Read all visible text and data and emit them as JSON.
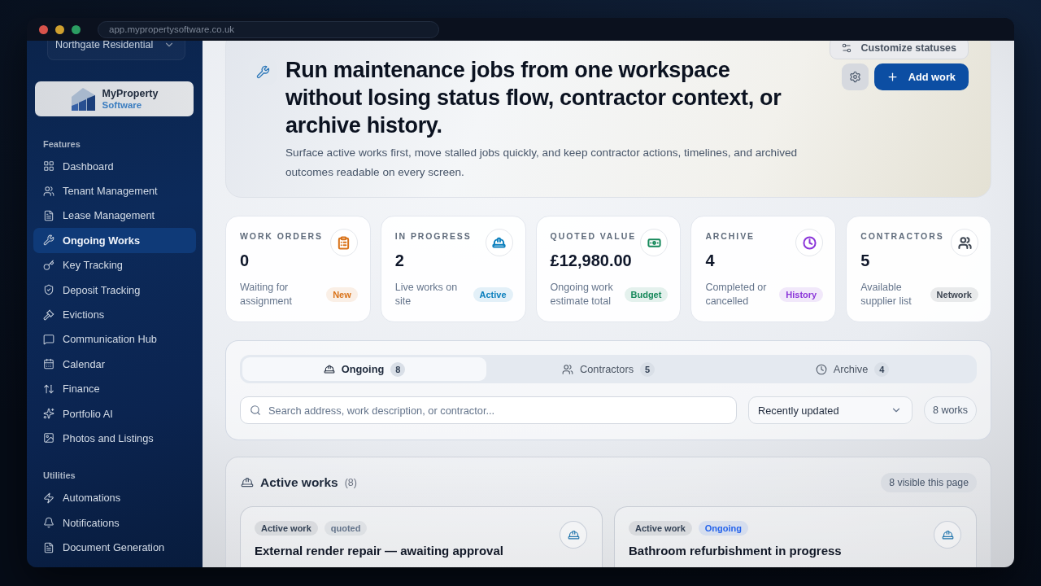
{
  "browser": {
    "url": "app.mypropertysoftware.co.uk"
  },
  "sidebar": {
    "workspace": "Northgate Residential",
    "logo": {
      "name": "MyProperty",
      "subtitle": "Software"
    },
    "sections": [
      {
        "title": "Features",
        "items": [
          {
            "label": "Dashboard",
            "selected": false
          },
          {
            "label": "Tenant Management",
            "selected": false
          },
          {
            "label": "Lease Management",
            "selected": false
          },
          {
            "label": "Ongoing Works",
            "selected": true
          },
          {
            "label": "Key Tracking",
            "selected": false
          },
          {
            "label": "Deposit Tracking",
            "selected": false
          },
          {
            "label": "Evictions",
            "selected": false
          },
          {
            "label": "Communication Hub",
            "selected": false
          },
          {
            "label": "Calendar",
            "selected": false
          },
          {
            "label": "Finance",
            "selected": false
          },
          {
            "label": "Portfolio AI",
            "selected": false
          },
          {
            "label": "Photos and Listings",
            "selected": false
          }
        ]
      },
      {
        "title": "Utilities",
        "items": [
          {
            "label": "Automations",
            "selected": false
          },
          {
            "label": "Notifications",
            "selected": false
          },
          {
            "label": "Document Generation",
            "selected": false
          }
        ]
      }
    ]
  },
  "hero": {
    "customize_button": "Customize statuses",
    "title": "Run maintenance jobs from one workspace without losing status flow, contractor context, or archive history.",
    "description": "Surface active works first, move stalled jobs quickly, and keep contractor actions, timelines, and archived outcomes readable on every screen.",
    "add_button": "Add work"
  },
  "stats": [
    {
      "label": "WORK ORDERS",
      "value": "0",
      "note": "Waiting for assignment",
      "badge": "New",
      "color": "#d9731a"
    },
    {
      "label": "IN PROGRESS",
      "value": "2",
      "note": "Live works on site",
      "badge": "Active",
      "color": "#0b7fbd"
    },
    {
      "label": "QUOTED VALUE",
      "value": "£12,980.00",
      "note": "Ongoing work estimate total",
      "badge": "Budget",
      "color": "#15885a"
    },
    {
      "label": "ARCHIVE",
      "value": "4",
      "note": "Completed or cancelled",
      "badge": "History",
      "color": "#8b36d9"
    },
    {
      "label": "CONTRACTORS",
      "value": "5",
      "note": "Available supplier list",
      "badge": "Network",
      "color": "#3f4753"
    }
  ],
  "filters": {
    "tabs": [
      {
        "label": "Ongoing",
        "count": "8",
        "selected": true
      },
      {
        "label": "Contractors",
        "count": "5",
        "selected": false
      },
      {
        "label": "Archive",
        "count": "4",
        "selected": false
      }
    ],
    "search": {
      "placeholder": "Search address, work description, or contractor..."
    },
    "sort": {
      "value": "Recently updated"
    },
    "result_count": "8 works"
  },
  "active_works": {
    "title": "Active works",
    "count": "(8)",
    "visible_badge": "8 visible this page",
    "cards": [
      {
        "tags": [
          {
            "label": "Active work",
            "color": "#334155"
          },
          {
            "label": "quoted",
            "color": "#64748b"
          }
        ],
        "title": "External render repair — awaiting approval"
      },
      {
        "tags": [
          {
            "label": "Active work",
            "color": "#334155"
          },
          {
            "label": "Ongoing",
            "color": "#2563eb"
          }
        ],
        "title": "Bathroom refurbishment in progress"
      }
    ]
  }
}
